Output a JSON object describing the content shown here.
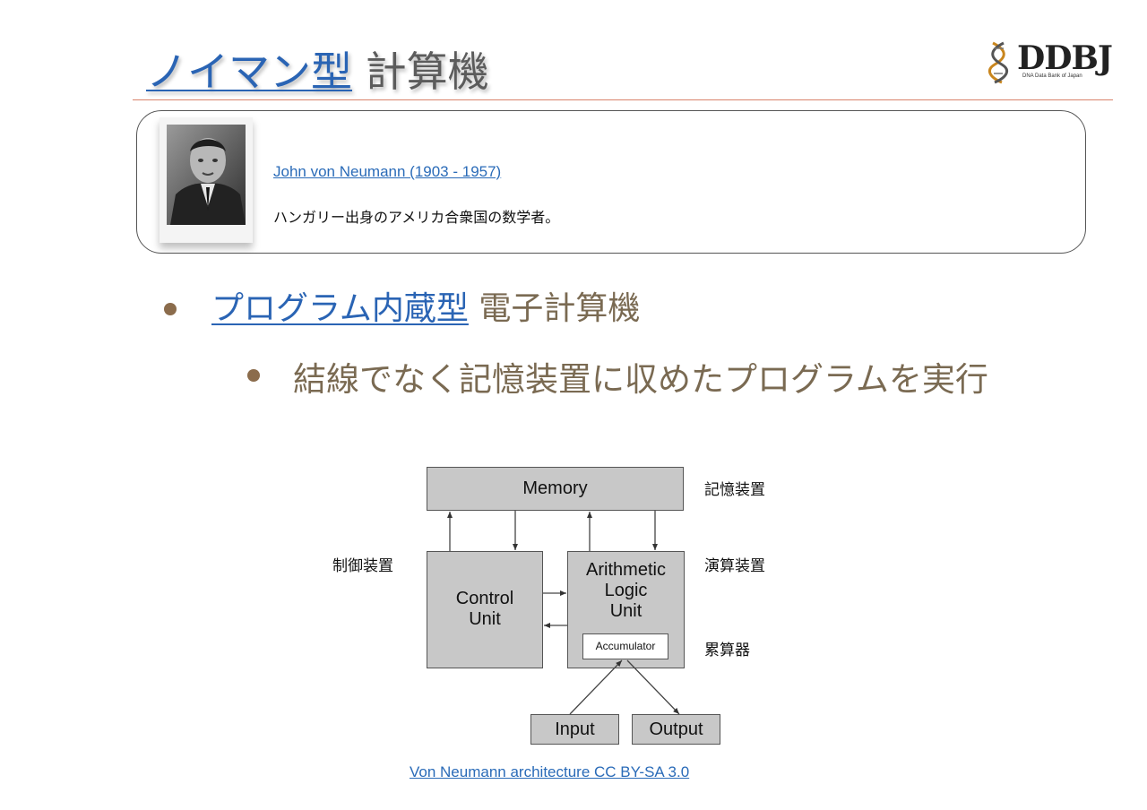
{
  "header": {
    "title_link": "ノイマン型",
    "title_rest": " 計算機",
    "logo_text": "DDBJ",
    "logo_sub": "DNA Data Bank of Japan"
  },
  "profile": {
    "name_link": "John von Neumann (1903 - 1957)",
    "description": "ハンガリー出身のアメリカ合衆国の数学者。"
  },
  "bullets": {
    "level1_link": "プログラム内蔵型",
    "level1_rest": " 電子計算機",
    "level2": "結線でなく記憶装置に収めたプログラムを実行"
  },
  "diagram": {
    "memory": "Memory",
    "control_unit_line1": "Control",
    "control_unit_line2": "Unit",
    "alu_line1": "Arithmetic",
    "alu_line2": "Logic",
    "alu_line3": "Unit",
    "accumulator": "Accumulator",
    "input": "Input",
    "output": "Output",
    "label_memory_jp": "記憶装置",
    "label_alu_jp": "演算装置",
    "label_control_jp": "制御装置",
    "label_accumulator_jp": "累算器"
  },
  "caption": "Von Neumann architecture CC BY-SA 3.0",
  "colors": {
    "link": "#2a64b4",
    "bullet": "#8b6c4c",
    "body_text": "#7a6a52",
    "rule": "#d9836a"
  }
}
